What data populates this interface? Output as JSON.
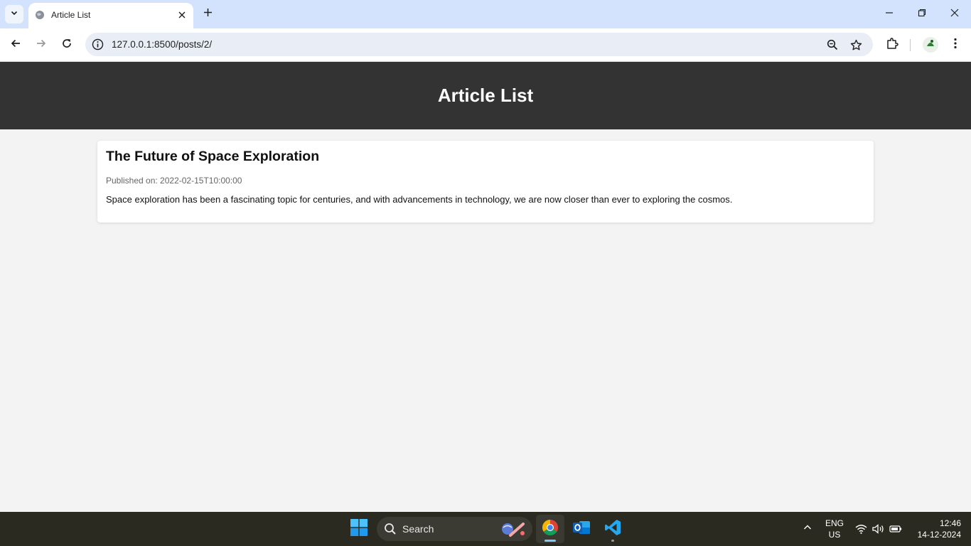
{
  "browser": {
    "tab": {
      "title": "Article List"
    },
    "url": "127.0.0.1:8500/posts/2/"
  },
  "page": {
    "header_title": "Article List",
    "articles": [
      {
        "title": "The Future of Space Exploration",
        "published": "Published on: 2022-02-15T10:00:00",
        "summary": "Space exploration has been a fascinating topic for centuries, and with advancements in technology, we are now closer than ever to exploring the cosmos."
      }
    ]
  },
  "taskbar": {
    "search_label": "Search",
    "language": {
      "line1": "ENG",
      "line2": "US"
    },
    "clock": {
      "time": "12:46",
      "date": "14-12-2024"
    }
  },
  "colors": {
    "tabstrip": "#d3e3fd",
    "header_bg": "#333333",
    "page_bg": "#f3f3f3",
    "taskbar_bg": "#2a2a20"
  }
}
